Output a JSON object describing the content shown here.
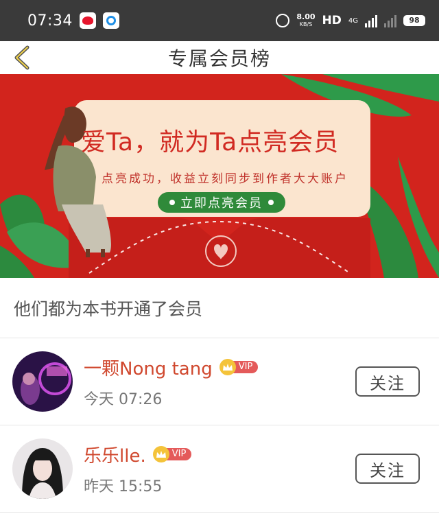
{
  "status_bar": {
    "time": "07:34",
    "net_speed_value": "8.00",
    "net_speed_unit": "KB/S",
    "hd_label": "HD",
    "network_label": "4G",
    "battery": "98"
  },
  "header": {
    "title": "专属会员榜"
  },
  "banner": {
    "title": "爱Ta，就为Ta点亮会员",
    "subtitle": "点亮成功，收益立刻同步到作者大大账户",
    "button_label": "立即点亮会员"
  },
  "section_title": "他们都为本书开通了会员",
  "members": [
    {
      "name": "一颗Nong tang",
      "vip_label": "VIP",
      "time": "今天 07:26",
      "follow_label": "关注"
    },
    {
      "name": "乐乐lle.",
      "vip_label": "VIP",
      "time": "昨天 15:55",
      "follow_label": "关注"
    }
  ],
  "colors": {
    "banner_red": "#d2241d",
    "card_cream": "#fbe5cf",
    "button_green": "#2f8a3a",
    "name_red": "#d0482e",
    "vip_red": "#e45a5a",
    "crown_gold": "#f4c33a"
  }
}
